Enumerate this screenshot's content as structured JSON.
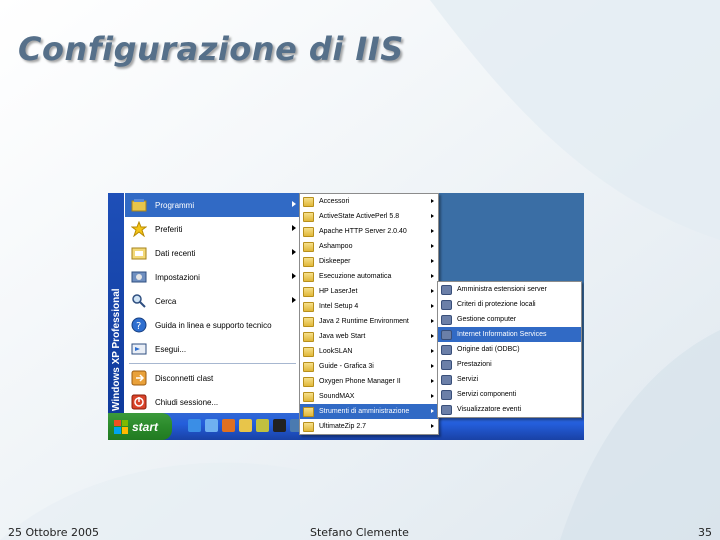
{
  "slide": {
    "title": "Configurazione di IIS",
    "footer_date": "25 Ottobre 2005",
    "footer_author": "Stefano Clemente",
    "page_number": "35"
  },
  "colors": {
    "title": "#56708a",
    "menu_highlight": "#316ac5",
    "xp_band": "#1e4fb8",
    "taskbar": "#245edb",
    "start_button": "#2b8a2b",
    "desktop": "#3a6ea5"
  },
  "start_menu": {
    "band_text": "Windows XP  Professional",
    "items": [
      {
        "label": "Programmi",
        "icon": "programs-icon",
        "arrow": true,
        "selected": true
      },
      {
        "label": "Preferiti",
        "icon": "star-icon",
        "arrow": true
      },
      {
        "label": "Dati recenti",
        "icon": "recent-icon",
        "arrow": true
      },
      {
        "label": "Impostazioni",
        "icon": "settings-icon",
        "arrow": true
      },
      {
        "label": "Cerca",
        "icon": "search-icon",
        "arrow": true
      },
      {
        "label": "Guida in linea e supporto tecnico",
        "icon": "help-icon"
      },
      {
        "label": "Esegui...",
        "icon": "run-icon"
      },
      {
        "label": "Disconnetti clast",
        "icon": "logoff-icon"
      },
      {
        "label": "Chiudi sessione...",
        "icon": "shutdown-icon"
      }
    ]
  },
  "taskbar": {
    "start_label": "start"
  },
  "programs_menu": {
    "items": [
      "Accessori",
      "ActiveState ActivePerl 5.8",
      "Apache HTTP Server 2.0.40",
      "Ashampoo",
      "Diskeeper",
      "Esecuzione automatica",
      "HP LaserJet",
      "Intel Setup 4",
      "Java 2 Runtime Environment",
      "Java web Start",
      "LookSLAN",
      "Guide - Grafica 3i",
      "Oxygen Phone Manager II",
      "SoundMAX",
      "Strumenti di amministrazione",
      "UltimateZip 2.7"
    ],
    "selected_index": 14
  },
  "admin_tools_menu": {
    "items": [
      "Amministra estensioni server",
      "Criteri di protezione locali",
      "Gestione computer",
      "Internet Information Services",
      "Origine dati (ODBC)",
      "Prestazioni",
      "Servizi",
      "Servizi componenti",
      "Visualizzatore eventi"
    ],
    "selected_index": 3
  }
}
